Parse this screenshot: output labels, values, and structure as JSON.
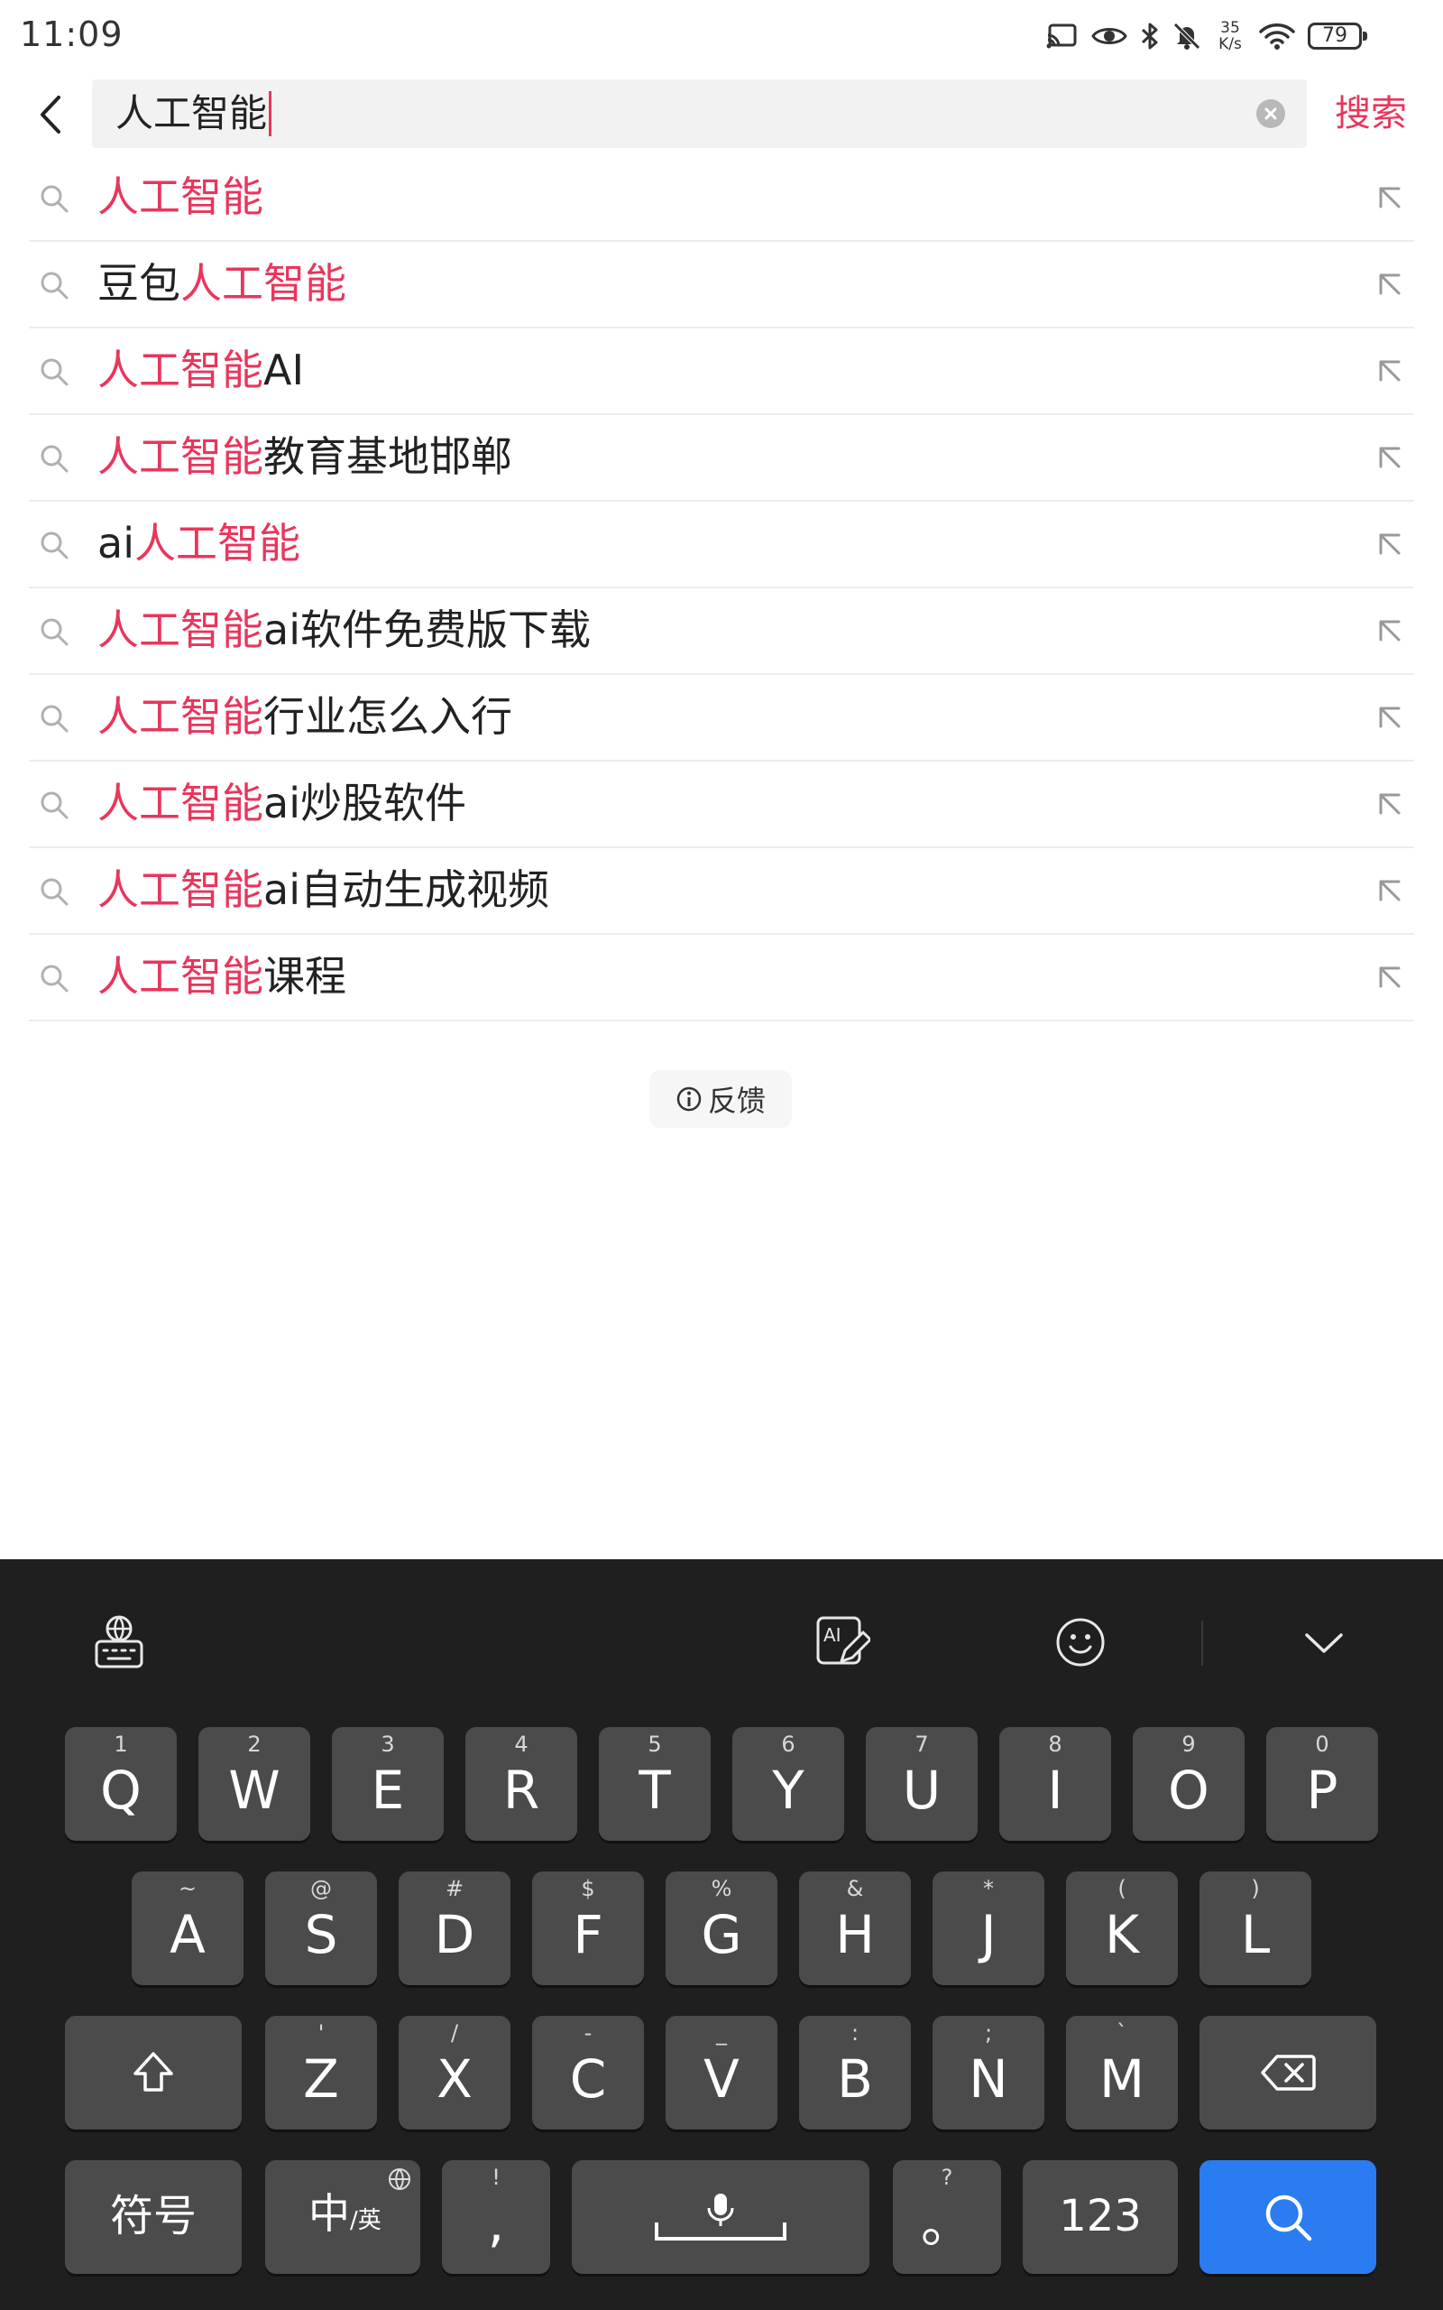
{
  "status_bar": {
    "time": "11:09",
    "net_speed_value": "35",
    "net_speed_unit": "K/s",
    "battery": "79",
    "icons": [
      "cast-icon",
      "eye-icon",
      "bluetooth-icon",
      "mute-bell-icon",
      "wifi-icon",
      "battery-icon"
    ]
  },
  "header": {
    "query": "人工智能",
    "search_label": "搜索"
  },
  "suggestions": [
    {
      "before": "",
      "highlight": "人工智能",
      "after": ""
    },
    {
      "before": "豆包",
      "highlight": "人工智能",
      "after": ""
    },
    {
      "before": "",
      "highlight": "人工智能",
      "after": "AI"
    },
    {
      "before": "",
      "highlight": "人工智能",
      "after": "教育基地邯郸"
    },
    {
      "before": "ai",
      "highlight": "人工智能",
      "after": ""
    },
    {
      "before": "",
      "highlight": "人工智能",
      "after": "ai软件免费版下载"
    },
    {
      "before": "",
      "highlight": "人工智能",
      "after": "行业怎么入行"
    },
    {
      "before": "",
      "highlight": "人工智能",
      "after": "ai炒股软件"
    },
    {
      "before": "",
      "highlight": "人工智能",
      "after": "ai自动生成视频"
    },
    {
      "before": "",
      "highlight": "人工智能",
      "after": "课程"
    }
  ],
  "feedback_label": "反馈",
  "keyboard": {
    "row1": [
      {
        "main": "Q",
        "sub": "1"
      },
      {
        "main": "W",
        "sub": "2"
      },
      {
        "main": "E",
        "sub": "3"
      },
      {
        "main": "R",
        "sub": "4"
      },
      {
        "main": "T",
        "sub": "5"
      },
      {
        "main": "Y",
        "sub": "6"
      },
      {
        "main": "U",
        "sub": "7"
      },
      {
        "main": "I",
        "sub": "8"
      },
      {
        "main": "O",
        "sub": "9"
      },
      {
        "main": "P",
        "sub": "0"
      }
    ],
    "row2": [
      {
        "main": "A",
        "sub": "~"
      },
      {
        "main": "S",
        "sub": "@"
      },
      {
        "main": "D",
        "sub": "#"
      },
      {
        "main": "F",
        "sub": "$"
      },
      {
        "main": "G",
        "sub": "%"
      },
      {
        "main": "H",
        "sub": "&"
      },
      {
        "main": "J",
        "sub": "*"
      },
      {
        "main": "K",
        "sub": "("
      },
      {
        "main": "L",
        "sub": ")"
      }
    ],
    "row3": [
      {
        "main": "Z",
        "sub": "'"
      },
      {
        "main": "X",
        "sub": "/"
      },
      {
        "main": "C",
        "sub": "-"
      },
      {
        "main": "V",
        "sub": "_"
      },
      {
        "main": "B",
        "sub": ":"
      },
      {
        "main": "N",
        "sub": ";"
      },
      {
        "main": "M",
        "sub": "`"
      }
    ],
    "symbols_label": "符号",
    "lang_main": "中",
    "lang_alt": "/英",
    "comma_main": ",",
    "comma_sub": "!",
    "period_main": "。",
    "period_sub": "?",
    "numbers_label": "123"
  }
}
